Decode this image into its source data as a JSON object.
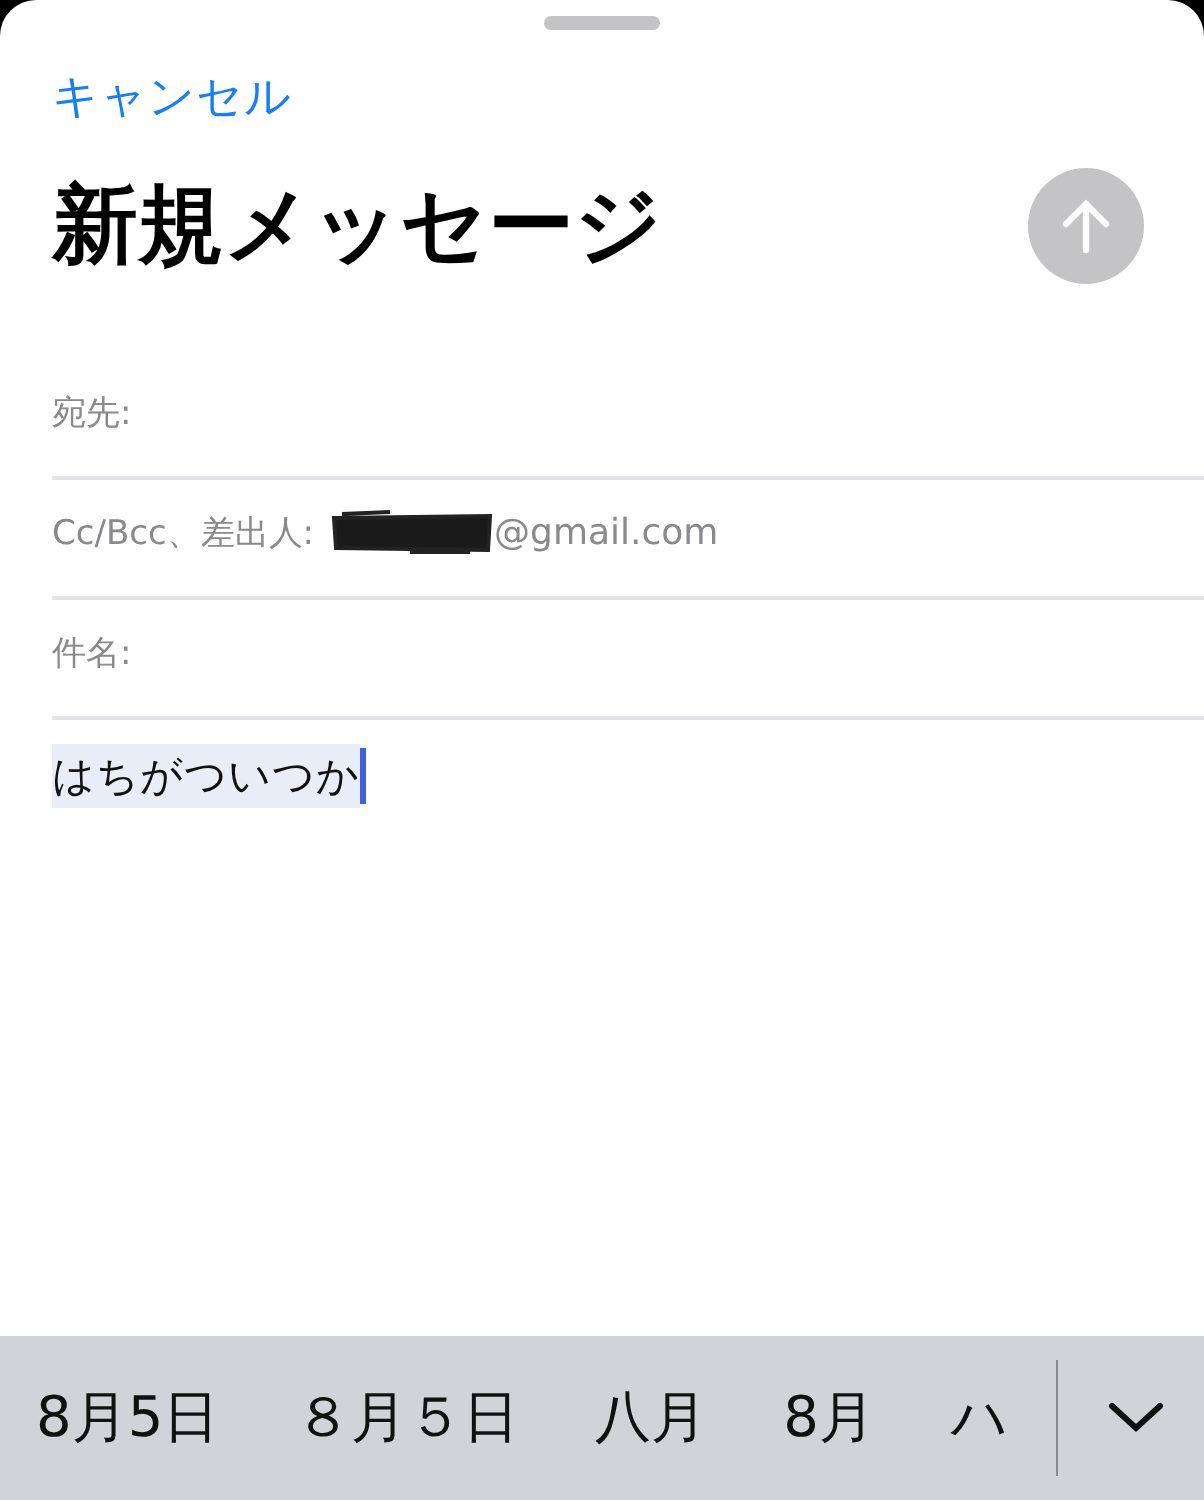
{
  "nav": {
    "cancel": "キャンセル"
  },
  "title": "新規メッセージ",
  "send_button": {
    "disabled": true
  },
  "fields": [
    {
      "label": "宛先:"
    },
    {
      "label": "Cc/Bcc、差出人:",
      "value": "@gmail.com",
      "redacted": true
    },
    {
      "label": "件名:"
    }
  ],
  "body": {
    "text": "はちがついつか",
    "selected": true
  },
  "candidates": [
    {
      "text": "8月5日"
    },
    {
      "text": "８月５日"
    },
    {
      "text": "八月"
    },
    {
      "text": "8月"
    },
    {
      "text": "ハ"
    }
  ]
}
